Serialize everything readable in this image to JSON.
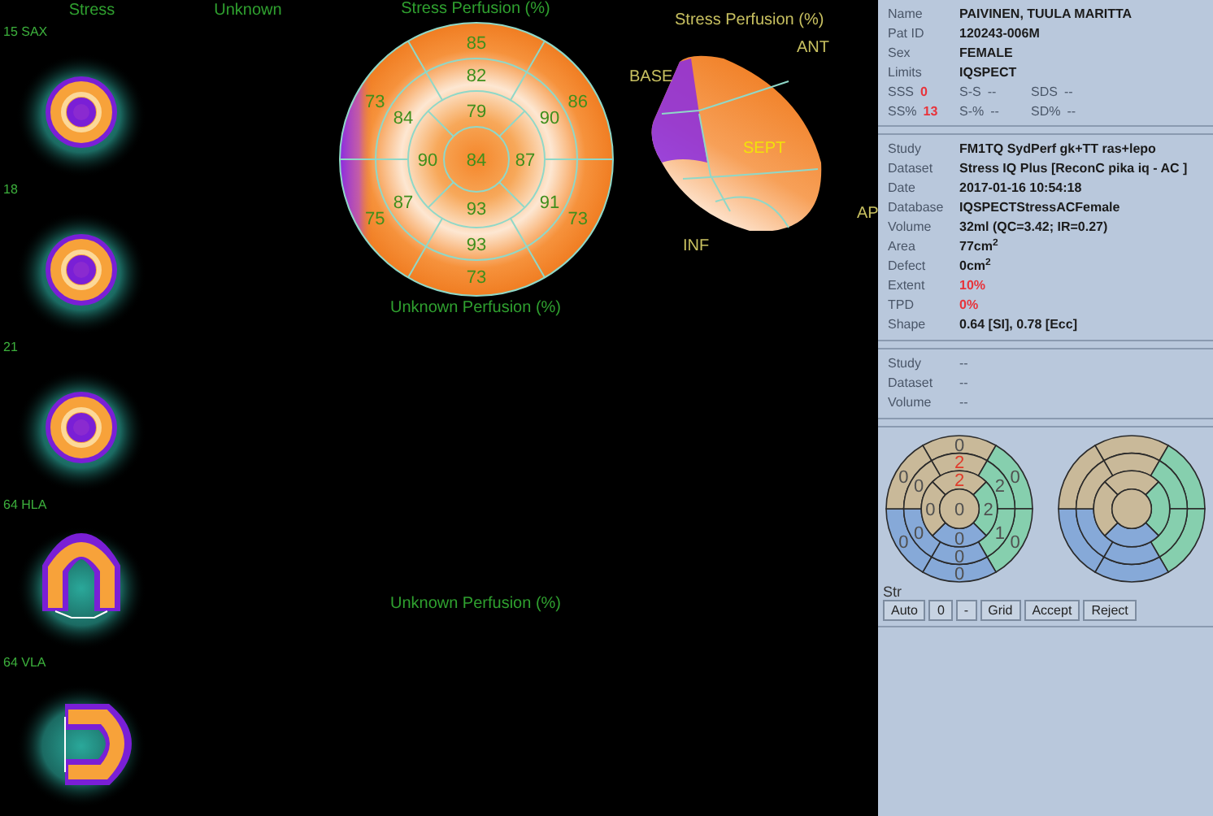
{
  "columns": [
    "Stress",
    "Unknown"
  ],
  "slices": [
    {
      "label": "15 SAX",
      "kind": "sax"
    },
    {
      "label": "18",
      "kind": "sax"
    },
    {
      "label": "21",
      "kind": "sax"
    },
    {
      "label": "64 HLA",
      "kind": "hla"
    },
    {
      "label": "64 VLA",
      "kind": "vla"
    }
  ],
  "polar_map": {
    "title": "Stress Perfusion (%)",
    "caption": "Unknown Perfusion (%)",
    "rings": [
      [
        "85",
        "86",
        "73",
        "73",
        "75",
        "73"
      ],
      [
        "82",
        "90",
        "91",
        "93",
        "87",
        "84"
      ],
      [
        "79",
        "87",
        "93",
        "90"
      ],
      [
        "84"
      ]
    ]
  },
  "lower_caption": "Unknown Perfusion (%)",
  "surface": {
    "title": "Stress Perfusion (%)",
    "labels": [
      {
        "text": "BASE",
        "kind": "base"
      },
      {
        "text": "ANT",
        "kind": "ant"
      },
      {
        "text": "SEPT",
        "kind": "sept"
      },
      {
        "text": "INF",
        "kind": "inf"
      },
      {
        "text": "AP",
        "kind": "apex"
      }
    ]
  },
  "patient": [
    {
      "label": "Name",
      "value": "PAIVINEN, TUULA MARITTA"
    },
    {
      "label": "Pat ID",
      "value": "120243-006M"
    },
    {
      "label": "Sex",
      "value": "FEMALE"
    },
    {
      "label": "Limits",
      "value": "IQSPECT"
    }
  ],
  "score_rows": [
    [
      {
        "label": "SSS",
        "value": "0",
        "alert": true
      },
      {
        "label": "S-S",
        "value": "--",
        "alert": false
      },
      {
        "label": "SDS",
        "value": "--",
        "alert": false
      }
    ],
    [
      {
        "label": "SS%",
        "value": "13",
        "alert": true
      },
      {
        "label": "S-%",
        "value": "--",
        "alert": false
      },
      {
        "label": "SD%",
        "value": "--",
        "alert": false
      }
    ]
  ],
  "study": [
    {
      "label": "Study",
      "value": "FM1TQ SydPerf gk+TT ras+lepo",
      "alert": false
    },
    {
      "label": "Dataset",
      "value": "Stress IQ Plus [ReconC pika iq - AC ]",
      "alert": false
    },
    {
      "label": "Date",
      "value": "2017-01-16 10:54:18",
      "alert": false
    },
    {
      "label": "Database",
      "value": "IQSPECTStressACFemale",
      "alert": false
    },
    {
      "label": "Volume",
      "value": "32ml (QC=3.42; IR=0.27)",
      "alert": false
    },
    {
      "label": "Area",
      "value": "77cm$^{2}$",
      "alert": false
    },
    {
      "label": "Defect",
      "value": "0cm$^{2}$",
      "alert": false
    },
    {
      "label": "Extent",
      "value": "10%",
      "alert": true
    },
    {
      "label": "TPD",
      "value": "0%",
      "alert": true
    },
    {
      "label": "Shape",
      "value": "0.64 [SI],  0.78 [Ecc]",
      "alert": false
    }
  ],
  "second_study": [
    {
      "label": "Study",
      "value": "--"
    },
    {
      "label": "Dataset",
      "value": "--"
    },
    {
      "label": "Volume",
      "value": "--"
    }
  ],
  "score_maps": [
    {
      "rings": [
        [
          {
            "score": "0",
            "alert": false,
            "color": "#c9b999"
          },
          {
            "score": "0",
            "alert": false,
            "color": "#86cfae"
          },
          {
            "score": "0",
            "alert": false,
            "color": "#86cfae"
          },
          {
            "score": "0",
            "alert": false,
            "color": "#86a9d8"
          },
          {
            "score": "0",
            "alert": false,
            "color": "#86a9d8"
          },
          {
            "score": "0",
            "alert": false,
            "color": "#c9b999"
          }
        ],
        [
          {
            "score": "2",
            "alert": true,
            "color": "#c9b999"
          },
          {
            "score": "2",
            "alert": false,
            "color": "#86cfae"
          },
          {
            "score": "1",
            "alert": false,
            "color": "#86cfae"
          },
          {
            "score": "0",
            "alert": false,
            "color": "#86a9d8"
          },
          {
            "score": "0",
            "alert": false,
            "color": "#86a9d8"
          },
          {
            "score": "0",
            "alert": false,
            "color": "#c9b999"
          }
        ],
        [
          {
            "score": "2",
            "alert": true,
            "color": "#c9b999"
          },
          {
            "score": "2",
            "alert": false,
            "color": "#86cfae"
          },
          {
            "score": "0",
            "alert": false,
            "color": "#86a9d8"
          },
          {
            "score": "0",
            "alert": false,
            "color": "#c9b999"
          }
        ],
        [
          {
            "score": "0",
            "alert": false,
            "color": "#c9b999"
          }
        ]
      ]
    },
    {
      "rings": [
        [
          {
            "color": "#c9b999"
          },
          {
            "color": "#86cfae"
          },
          {
            "color": "#86cfae"
          },
          {
            "color": "#86a9d8"
          },
          {
            "color": "#86a9d8"
          },
          {
            "color": "#c9b999"
          }
        ],
        [
          {
            "color": "#c9b999"
          },
          {
            "color": "#86cfae"
          },
          {
            "color": "#86cfae"
          },
          {
            "color": "#86a9d8"
          },
          {
            "color": "#86a9d8"
          },
          {
            "color": "#c9b999"
          }
        ],
        [
          {
            "color": "#c9b999"
          },
          {
            "color": "#86cfae"
          },
          {
            "color": "#86a9d8"
          },
          {
            "color": "#c9b999"
          }
        ],
        [
          {
            "color": "#c9b999"
          }
        ]
      ]
    }
  ],
  "map_label": "Str",
  "buttons": [
    "Auto",
    "0",
    "-",
    "Grid",
    "Accept",
    "Reject"
  ]
}
